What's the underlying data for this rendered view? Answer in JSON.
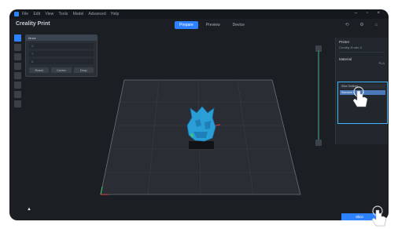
{
  "menubar": {
    "items": [
      "File",
      "Edit",
      "View",
      "Tools",
      "Model",
      "Advanced",
      "Help"
    ],
    "controls": "– ▫ ×"
  },
  "app": {
    "title": "Creality Print"
  },
  "tabs": [
    {
      "label": "Prepare",
      "active": true
    },
    {
      "label": "Preview",
      "active": false
    },
    {
      "label": "Device",
      "active": false
    }
  ],
  "header_icons": "⟲ ⚙ ⌂",
  "param_panel": {
    "title": "Move",
    "rows": [
      "X",
      "Y",
      "Z"
    ],
    "buttons": [
      "Reset",
      "Center",
      "Drop"
    ]
  },
  "right_panel": {
    "title": "Printer",
    "subtitle": "Creality Ender-3",
    "section": "Material",
    "value": "PLA",
    "highlight": {
      "header": "Slice Settings",
      "selected": "Standard"
    }
  },
  "colors": {
    "accent": "#2f82ff",
    "highlight": "#3fb6ff",
    "model": "#2a9fd6"
  },
  "action_button": {
    "label": "Slice"
  }
}
